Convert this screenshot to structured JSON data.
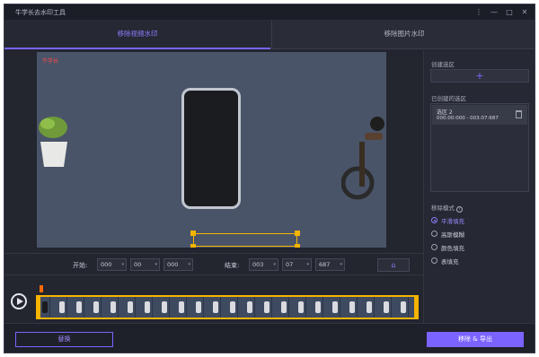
{
  "app": {
    "title": "牛学长去水印工具"
  },
  "window_controls": {
    "minimize": "—",
    "restore": "□",
    "close": "✕",
    "menu": "⋮"
  },
  "tabs": [
    {
      "label": "移除视频水印",
      "active": true
    },
    {
      "label": "移除图片水印",
      "active": false
    }
  ],
  "video": {
    "watermark_text": "牛学长"
  },
  "time": {
    "start_label": "开始:",
    "start": [
      "000",
      "00",
      "000"
    ],
    "end_label": "结束:",
    "end": [
      "003",
      "07",
      "687"
    ]
  },
  "right_panel": {
    "create_title": "创建选区",
    "add_symbol": "+",
    "created_title": "已创建的选区",
    "region": {
      "name": "选区 2",
      "range": "000:00:000 - 003:07:687"
    },
    "mode_title": "移除模式",
    "modes": [
      {
        "label": "平滑填充",
        "selected": true
      },
      {
        "label": "高斯模糊",
        "selected": false
      },
      {
        "label": "颜色填充",
        "selected": false
      },
      {
        "label": "表填充",
        "selected": false
      }
    ]
  },
  "bottom": {
    "replace_label": "替换",
    "export_label": "移除 & 导出"
  },
  "colors": {
    "accent": "#7b63ff",
    "selection": "#f5b400",
    "playhead": "#ff6a00"
  }
}
